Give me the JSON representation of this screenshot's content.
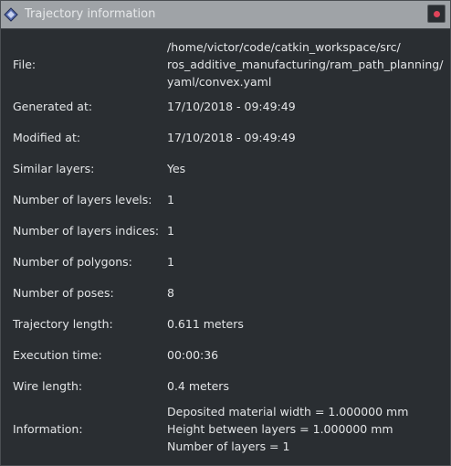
{
  "window": {
    "title": "Trajectory information",
    "close_icon": "close-icon",
    "title_icon": "diamond-app-icon",
    "colors": {
      "titlebar": "#9fa3a7",
      "background": "#2a2e32",
      "text": "#e3e5e7",
      "close_accent": "#e0445a"
    }
  },
  "fields": {
    "file": {
      "label": "File:",
      "lines": [
        "/home/victor/code/catkin_workspace/src/",
        "ros_additive_manufacturing/ram_path_planning/",
        "yaml/convex.yaml"
      ]
    },
    "generated_at": {
      "label": "Generated at:",
      "value": "17/10/2018 - 09:49:49"
    },
    "modified_at": {
      "label": "Modified at:",
      "value": "17/10/2018 - 09:49:49"
    },
    "similar_layers": {
      "label": "Similar layers:",
      "value": "Yes"
    },
    "layers_levels": {
      "label": "Number of layers levels:",
      "value": "1"
    },
    "layers_indices": {
      "label": "Number of layers indices:",
      "value": "1"
    },
    "polygons": {
      "label": "Number of polygons:",
      "value": "1"
    },
    "poses": {
      "label": "Number of poses:",
      "value": "8"
    },
    "trajectory_length": {
      "label": "Trajectory length:",
      "value": "0.611 meters"
    },
    "execution_time": {
      "label": "Execution time:",
      "value": "00:00:36"
    },
    "wire_length": {
      "label": "Wire length:",
      "value": "0.4 meters"
    },
    "information": {
      "label": "Information:",
      "lines": [
        "Deposited material width = 1.000000 mm",
        "Height between layers = 1.000000 mm",
        "Number of layers = 1"
      ]
    }
  }
}
